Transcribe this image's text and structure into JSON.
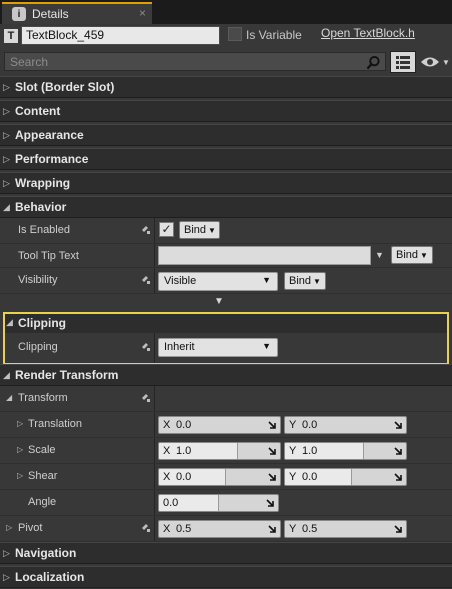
{
  "tab": {
    "title": "Details",
    "close": "×",
    "icon": "details-icon"
  },
  "header": {
    "name_value": "TextBlock_459",
    "is_variable_label": "Is Variable",
    "is_variable_checked": false,
    "open_link": "Open TextBlock.h"
  },
  "search": {
    "placeholder": "Search"
  },
  "sections": {
    "slot": "Slot (Border Slot)",
    "content": "Content",
    "appearance": "Appearance",
    "performance": "Performance",
    "wrapping": "Wrapping",
    "behavior": "Behavior",
    "clipping": "Clipping",
    "render_transform": "Render Transform",
    "navigation": "Navigation",
    "localization": "Localization"
  },
  "behavior": {
    "is_enabled_label": "Is Enabled",
    "is_enabled_checked": true,
    "tooltip_label": "Tool Tip Text",
    "tooltip_value": "",
    "visibility_label": "Visibility",
    "visibility_value": "Visible",
    "bind_label": "Bind"
  },
  "clipping": {
    "label": "Clipping",
    "value": "Inherit"
  },
  "render_transform": {
    "transform_label": "Transform",
    "translation_label": "Translation",
    "translation_x": "0.0",
    "translation_y": "0.0",
    "scale_label": "Scale",
    "scale_x": "1.0",
    "scale_y": "1.0",
    "shear_label": "Shear",
    "shear_x": "0.0",
    "shear_y": "0.0",
    "angle_label": "Angle",
    "angle_value": "0.0",
    "pivot_label": "Pivot",
    "pivot_x": "0.5",
    "pivot_y": "0.5",
    "axis_x": "X",
    "axis_y": "Y"
  },
  "colors": {
    "highlight": "#e8d24a",
    "tab_accent": "#e0a000",
    "section_bg": "#2d2d2d",
    "row_bg": "#383838"
  }
}
